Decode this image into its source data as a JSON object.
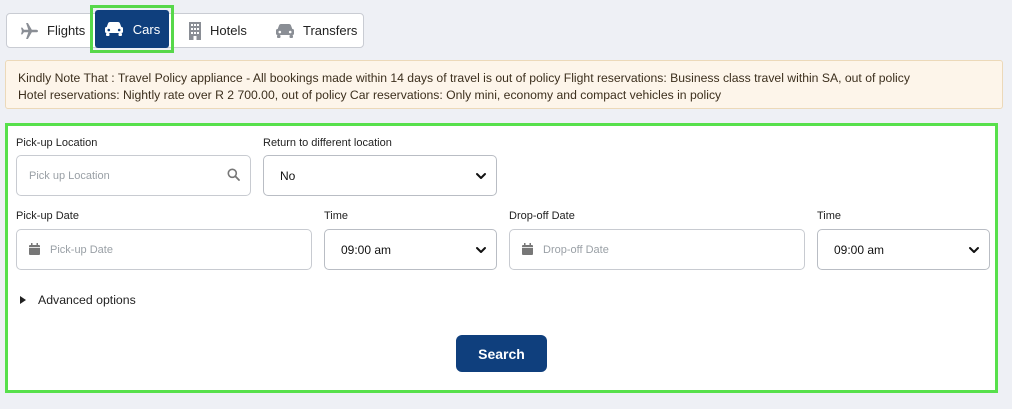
{
  "tabs": {
    "flights": "Flights",
    "cars": "Cars",
    "hotels": "Hotels",
    "transfers": "Transfers",
    "active": "Cars"
  },
  "notice": {
    "line1": "Kindly Note That : Travel Policy appliance - All bookings made within 14 days of travel is out of policy Flight reservations: Business class travel within SA, out of policy",
    "line2": "Hotel reservations: Nightly rate over R 2 700.00, out of policy Car reservations: Only mini, economy and compact vehicles in policy"
  },
  "form": {
    "pickup_location_label": "Pick-up Location",
    "pickup_location_placeholder": "Pick up Location",
    "return_label": "Return to different location",
    "return_value": "No",
    "pickup_date_label": "Pick-up Date",
    "pickup_date_placeholder": "Pick-up Date",
    "pickup_time_label": "Time",
    "pickup_time_value": "09:00 am",
    "dropoff_date_label": "Drop-off Date",
    "dropoff_date_placeholder": "Drop-off Date",
    "dropoff_time_label": "Time",
    "dropoff_time_value": "09:00 am",
    "advanced_label": "Advanced options",
    "search_label": "Search"
  },
  "colors": {
    "primary": "#0f3f7d",
    "highlight": "#57e04b",
    "notice_bg": "#fdf5ea"
  }
}
